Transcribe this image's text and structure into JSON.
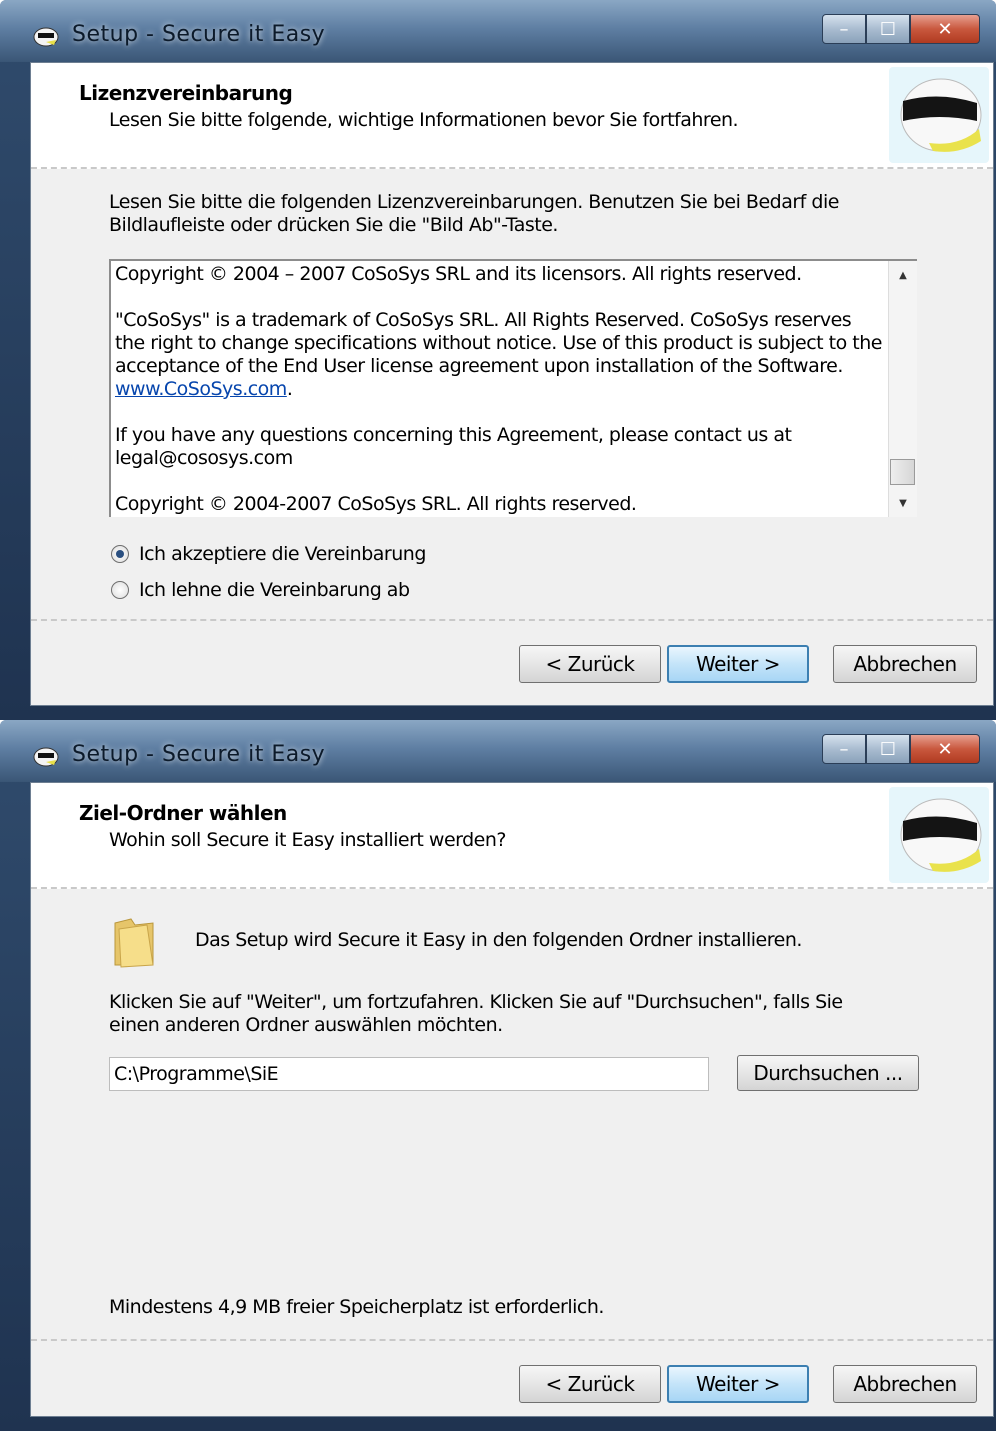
{
  "windows": [
    {
      "title": "Setup - Secure it Easy",
      "header": {
        "title": "Lizenzvereinbarung",
        "subtitle": "Lesen Sie bitte folgende, wichtige Informationen bevor Sie fortfahren."
      },
      "intro_line1": "Lesen Sie bitte die folgenden Lizenzvereinbarungen. Benutzen Sie bei Bedarf die",
      "intro_line2": "Bildlaufleiste oder drücken Sie die \"Bild Ab\"-Taste.",
      "license": {
        "para1": "Copyright © 2004 – 2007 CoSoSys SRL and its licensors. All rights reserved.",
        "para2": "\"CoSoSys\" is a trademark of CoSoSys SRL. All Rights Reserved. CoSoSys reserves the right to change specifications without notice. Use of this product is subject to the acceptance of the End User license agreement upon installation of the Software.",
        "link": "www.CoSoSys.com",
        "para3": "If you have any questions concerning this Agreement, please contact us at legal@cososys.com",
        "para4": "Copyright © 2004-2007 CoSoSys SRL. All rights reserved."
      },
      "radio_accept": "Ich akzeptiere die Vereinbarung",
      "radio_decline": "Ich lehne die Vereinbarung ab",
      "buttons": {
        "back": "< Zurück",
        "next": "Weiter >",
        "cancel": "Abbrechen"
      }
    },
    {
      "title": "Setup - Secure it Easy",
      "header": {
        "title": "Ziel-Ordner wählen",
        "subtitle": "Wohin soll Secure it Easy installiert werden?"
      },
      "folder_text": "Das Setup wird Secure it Easy in den folgenden Ordner installieren.",
      "instr_line1": "Klicken Sie auf \"Weiter\", um fortzufahren. Klicken Sie auf \"Durchsuchen\", falls Sie",
      "instr_line2": "einen anderen Ordner auswählen möchten.",
      "path_value": "C:\\Programme\\SiE",
      "browse": "Durchsuchen ...",
      "space_note": "Mindestens 4,9 MB freier Speicherplatz ist erforderlich.",
      "buttons": {
        "back": "< Zurück",
        "next": "Weiter >",
        "cancel": "Abbrechen"
      }
    }
  ],
  "icons": [
    "helmet-icon",
    "folder-icon",
    "minimize-icon",
    "maximize-icon",
    "close-icon"
  ],
  "colors": {
    "accent": "#3c7fb1",
    "link": "#0645ad",
    "titlebar": "#5f7fa3"
  }
}
